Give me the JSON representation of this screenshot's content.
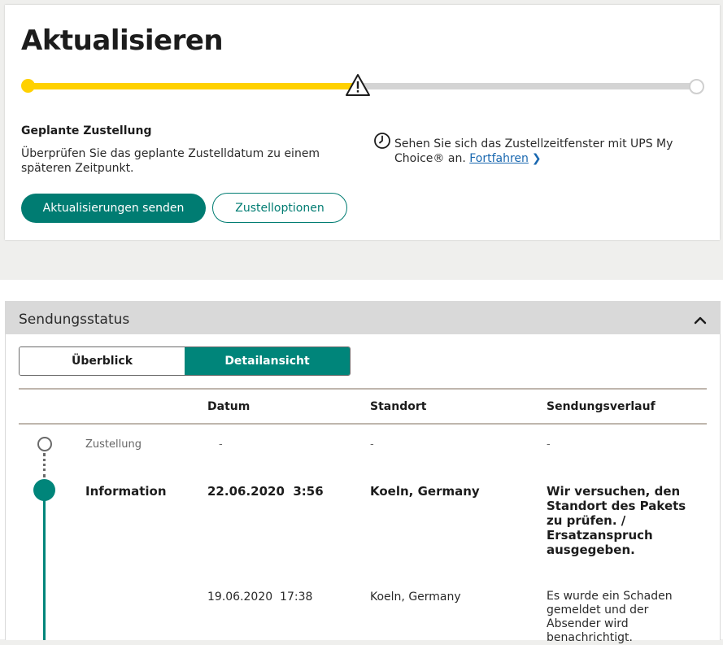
{
  "update_card": {
    "title": "Aktualisieren",
    "progress": 0.5,
    "planned_title": "Geplante Zustellung",
    "planned_desc": "Überprüfen Sie das geplante Zustelldatum zu einem späteren Zeitpunkt.",
    "mychoice_text": "Sehen Sie sich das Zustellzeitfenster mit UPS My Choice® an.",
    "mychoice_link": "Fortfahren",
    "send_updates_label": "Aktualisierungen senden",
    "delivery_options_label": "Zustelloptionen"
  },
  "status_panel": {
    "title": "Sendungsstatus",
    "tabs": [
      {
        "label": "Überblick",
        "active": false
      },
      {
        "label": "Detailansicht",
        "active": true
      }
    ],
    "columns": [
      "Datum",
      "Standort",
      "Sendungsverlauf"
    ],
    "rows": [
      {
        "status": "Zustellung",
        "date": "-",
        "location": "-",
        "activity": "-"
      },
      {
        "status": "Information",
        "date": "22.06.2020  3:56",
        "location": "Koeln, Germany",
        "activity": "Wir versuchen, den Standort des Pakets zu prüfen. / Ersatzanspruch ausgegeben."
      },
      {
        "status": "",
        "date": "19.06.2020  17:38",
        "location": "Koeln, Germany",
        "activity": "Es wurde ein Schaden gemeldet und der Absender wird benachrichtigt."
      }
    ]
  },
  "colors": {
    "brand_teal": "#007c72",
    "progress_yellow": "#ffd100",
    "link_blue": "#1a68b0"
  },
  "icons": [
    "warning-triangle-icon",
    "clock-icon",
    "chevron-right-icon",
    "chevron-up-icon"
  ]
}
